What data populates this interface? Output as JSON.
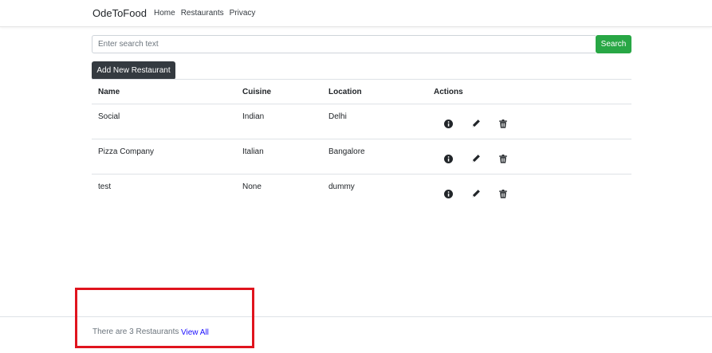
{
  "nav": {
    "brand": "OdeToFood",
    "links": [
      "Home",
      "Restaurants",
      "Privacy"
    ]
  },
  "search": {
    "placeholder": "Enter search text",
    "value": "",
    "button_label": "Search"
  },
  "add_button_label": "Add New Restaurant",
  "table": {
    "headers": [
      "Name",
      "Cuisine",
      "Location",
      "Actions"
    ],
    "rows": [
      [
        "Social",
        "Indian",
        "Delhi"
      ],
      [
        "Pizza Company",
        "Italian",
        "Bangalore"
      ],
      [
        "test",
        "None",
        "dummy"
      ]
    ],
    "action_icons": [
      "info-icon",
      "pencil-icon",
      "trash-icon"
    ]
  },
  "footer": {
    "text": "There are 3 Restaurants",
    "link": "View All"
  },
  "colors": {
    "search_button": "#28a745",
    "add_button": "#343a40",
    "link": "#1a0dff",
    "highlight": "#e0141e"
  }
}
